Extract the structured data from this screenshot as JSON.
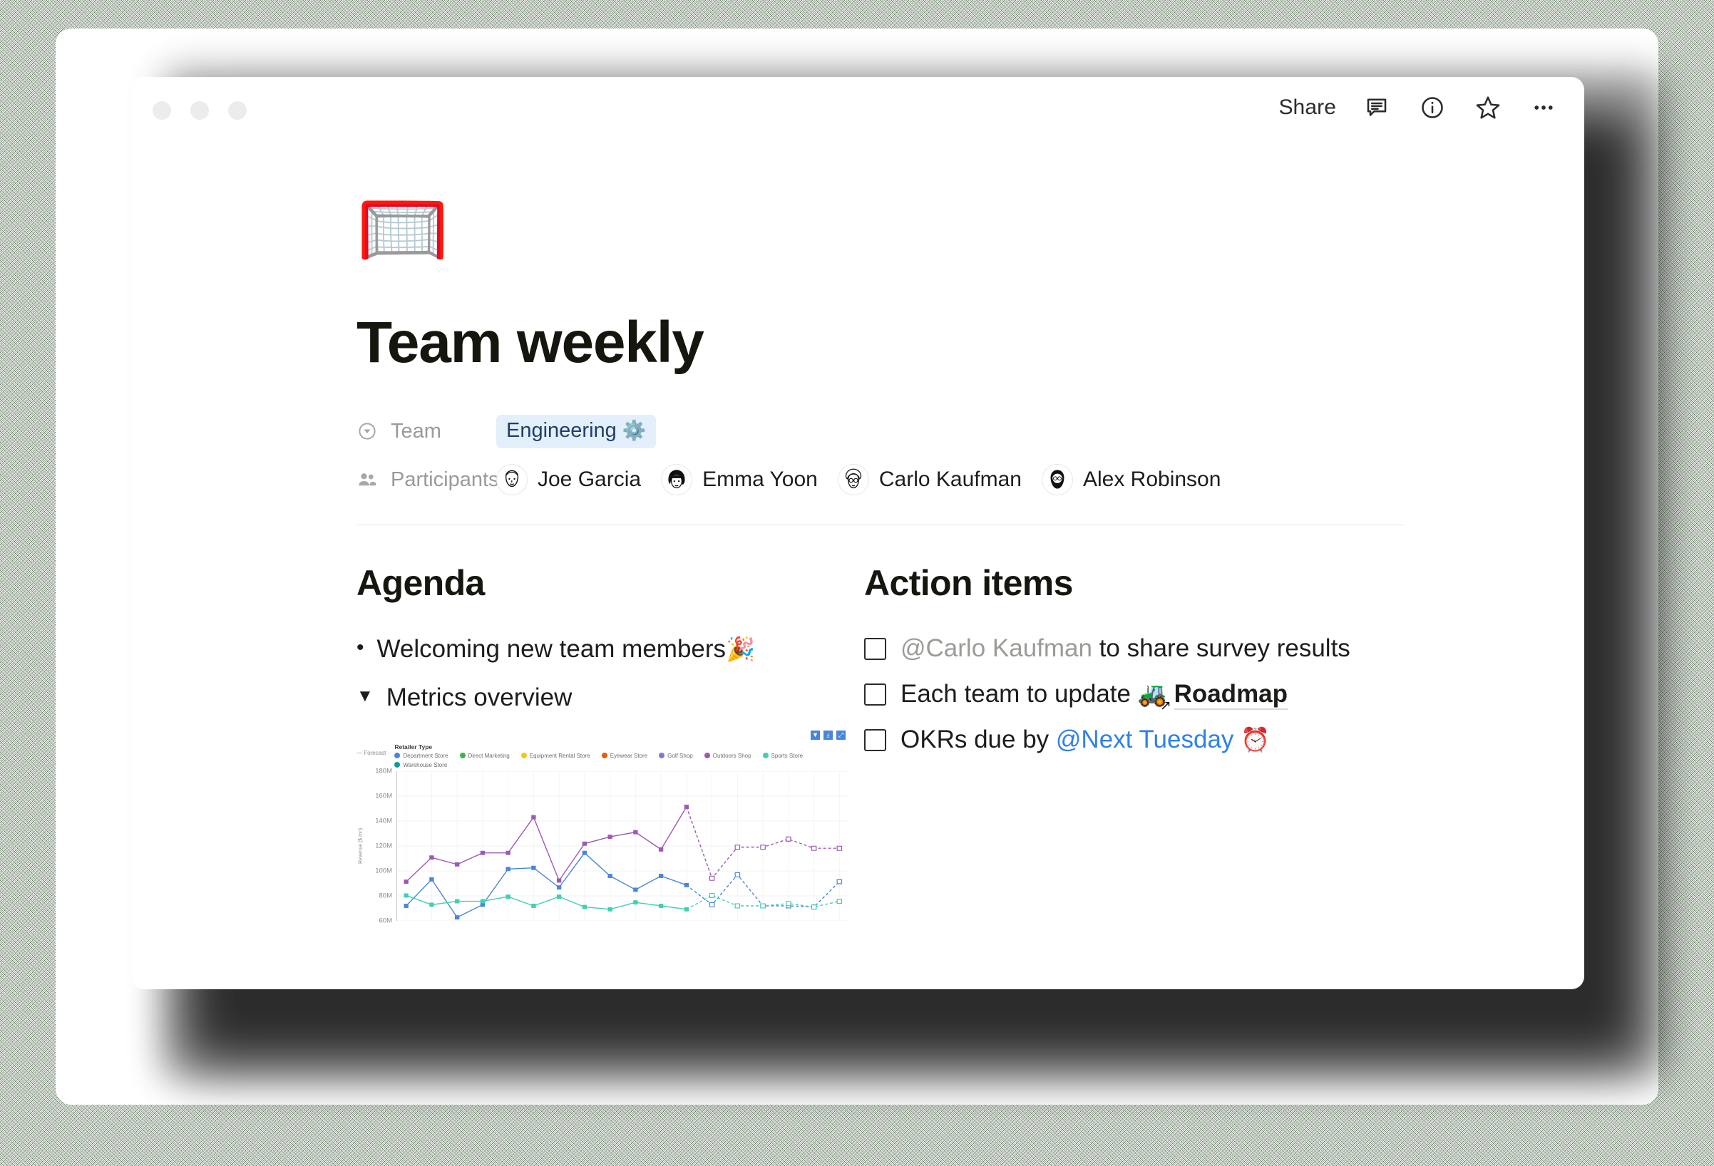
{
  "window": {
    "traffic_lights": [
      "close",
      "minimize",
      "maximize"
    ],
    "share_label": "Share",
    "actions": [
      {
        "name": "comment-icon",
        "label": "Comments"
      },
      {
        "name": "info-icon",
        "label": "Info"
      },
      {
        "name": "star-icon",
        "label": "Favorite"
      },
      {
        "name": "more-icon",
        "label": "More options"
      }
    ]
  },
  "page": {
    "emoji": "🥅",
    "emoji_name": "goal-net",
    "title": "Team weekly"
  },
  "properties": [
    {
      "label": "Team",
      "icon": "select-property-icon",
      "value": "Engineering",
      "value_emoji": "⚙️"
    },
    {
      "label": "Participants",
      "icon": "people-icon",
      "people": [
        "Joe Garcia",
        "Emma Yoon",
        "Carlo Kaufman",
        "Alex Robinson"
      ]
    }
  ],
  "agenda": {
    "heading": "Agenda",
    "items": [
      {
        "type": "bullet",
        "text": "Welcoming new team members",
        "emoji": "🎉"
      },
      {
        "type": "toggle",
        "text": "Metrics overview",
        "emoji": ""
      }
    ]
  },
  "action_items": {
    "heading": "Action items",
    "items": [
      {
        "checked": false,
        "mention": "@Carlo Kaufman",
        "mention_style": "gray",
        "text": " to share survey results"
      },
      {
        "checked": false,
        "text": "Each team to update ",
        "link_emoji": "🚜",
        "link_text": "Roadmap"
      },
      {
        "checked": false,
        "text": "OKRs due by ",
        "mention": "@Next Tuesday",
        "mention_style": "blue",
        "trailing_emoji": "⏰"
      }
    ]
  },
  "chart_data": {
    "type": "line",
    "title": "",
    "xlabel": "",
    "ylabel": "Revenue ($ mn)",
    "legend_title": "Retailer Type",
    "forecast_key": "Forecast",
    "legend_position": "top",
    "grid": true,
    "ylim": [
      50,
      180
    ],
    "yticks": [
      "180M",
      "160M",
      "140M",
      "120M",
      "100M",
      "80M",
      "60M"
    ],
    "forecast_start_index": 11,
    "toolbar_icons": [
      "filter-icon",
      "download-icon",
      "fullscreen-icon"
    ],
    "series": [
      {
        "name": "Department Store",
        "color": "#4a86d6",
        "values": [
          63,
          86,
          53,
          64,
          95,
          96,
          79,
          109,
          89,
          77,
          89,
          81,
          64,
          90,
          63,
          63,
          62,
          84
        ]
      },
      {
        "name": "Direct Marketing",
        "color": "#3cb44b",
        "values": []
      },
      {
        "name": "Equipment Rental Store",
        "color": "#f5c518",
        "values": []
      },
      {
        "name": "Eyewear Store",
        "color": "#e8590c",
        "values": []
      },
      {
        "name": "Golf Shop",
        "color": "#8e6fd8",
        "values": []
      },
      {
        "name": "Outdoors Shop",
        "color": "#9b59b6",
        "values": [
          84,
          105,
          99,
          109,
          109,
          140,
          85,
          117,
          123,
          127,
          112,
          149,
          87,
          114,
          114,
          121,
          113,
          113
        ]
      },
      {
        "name": "Sports Store",
        "color": "#3fd0b0",
        "values": [
          72,
          64,
          67,
          67,
          71,
          63,
          71,
          62,
          60,
          66,
          63,
          60,
          72,
          63,
          63,
          65,
          62,
          67
        ]
      },
      {
        "name": "Warehouse Store",
        "color": "#0f9b8e",
        "values": []
      }
    ]
  }
}
